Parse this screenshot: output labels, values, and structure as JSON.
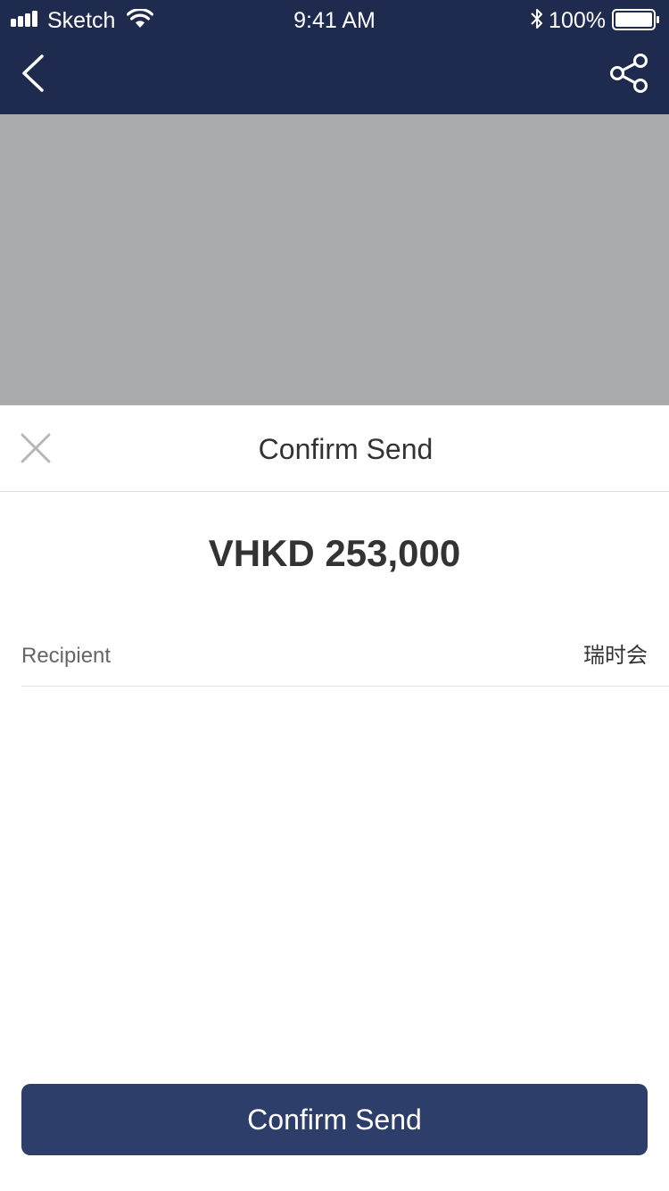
{
  "status_bar": {
    "carrier": "Sketch",
    "time": "9:41 AM",
    "battery": "100%",
    "icons": [
      "signal-icon",
      "wifi-icon",
      "bluetooth-icon",
      "battery-icon"
    ]
  },
  "nav": {
    "back_icon": "chevron-left-icon",
    "share_icon": "share-icon"
  },
  "dialog": {
    "close_icon": "close-icon",
    "title": "Confirm Send",
    "amount": "VHKD 253,000",
    "recipient_label": "Recipient",
    "recipient_value": "瑞时会",
    "confirm_button": "Confirm Send"
  },
  "colors": {
    "header_bg": "#1e2b4e",
    "overlay": "#a9aaac",
    "button_bg": "#2e3e6b"
  }
}
